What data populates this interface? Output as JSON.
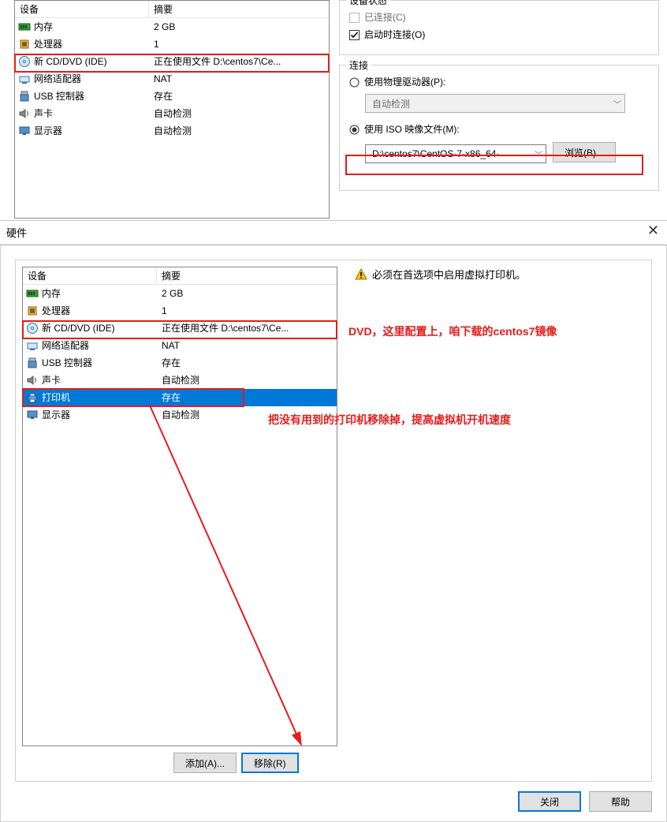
{
  "top": {
    "headers": {
      "device": "设备",
      "summary": "摘要"
    },
    "rows": [
      {
        "icon": "memory-icon",
        "name": "内存",
        "summary": "2 GB"
      },
      {
        "icon": "cpu-icon",
        "name": "处理器",
        "summary": "1"
      },
      {
        "icon": "cd-icon",
        "name": "新 CD/DVD (IDE)",
        "summary": "正在使用文件 D:\\centos7\\Ce..."
      },
      {
        "icon": "network-icon",
        "name": "网络适配器",
        "summary": "NAT"
      },
      {
        "icon": "usb-icon",
        "name": "USB 控制器",
        "summary": "存在"
      },
      {
        "icon": "sound-icon",
        "name": "声卡",
        "summary": "自动检测"
      },
      {
        "icon": "display-icon",
        "name": "显示器",
        "summary": "自动检测"
      }
    ],
    "status_group": "设备状态",
    "connected": "已连接(C)",
    "connect_on_start": "启动时连接(O)",
    "connection_group": "连接",
    "use_physical": "使用物理驱动器(P):",
    "physical_value": "自动检测",
    "use_iso": "使用 ISO 映像文件(M):",
    "iso_value": "D:\\centos7\\CentOS-7-x86_64-",
    "browse": "浏览(B)..."
  },
  "hw_label": "硬件",
  "bottom": {
    "headers": {
      "device": "设备",
      "summary": "摘要"
    },
    "rows": [
      {
        "icon": "memory-icon",
        "name": "内存",
        "summary": "2 GB"
      },
      {
        "icon": "cpu-icon",
        "name": "处理器",
        "summary": "1"
      },
      {
        "icon": "cd-icon",
        "name": "新 CD/DVD (IDE)",
        "summary": "正在使用文件 D:\\centos7\\Ce..."
      },
      {
        "icon": "network-icon",
        "name": "网络适配器",
        "summary": "NAT"
      },
      {
        "icon": "usb-icon",
        "name": "USB 控制器",
        "summary": "存在"
      },
      {
        "icon": "sound-icon",
        "name": "声卡",
        "summary": "自动检测"
      },
      {
        "icon": "printer-icon",
        "name": "打印机",
        "summary": "存在",
        "selected": true
      },
      {
        "icon": "display-icon",
        "name": "显示器",
        "summary": "自动检测"
      }
    ],
    "warning": "必须在首选项中启用虚拟打印机。",
    "add": "添加(A)...",
    "remove": "移除(R)",
    "close": "关闭",
    "help": "帮助"
  },
  "annotations": {
    "dvd": "DVD，这里配置上，咱下载的centos7镜像",
    "printer": "把没有用到的打印机移除掉，提高虚拟机开机速度"
  }
}
